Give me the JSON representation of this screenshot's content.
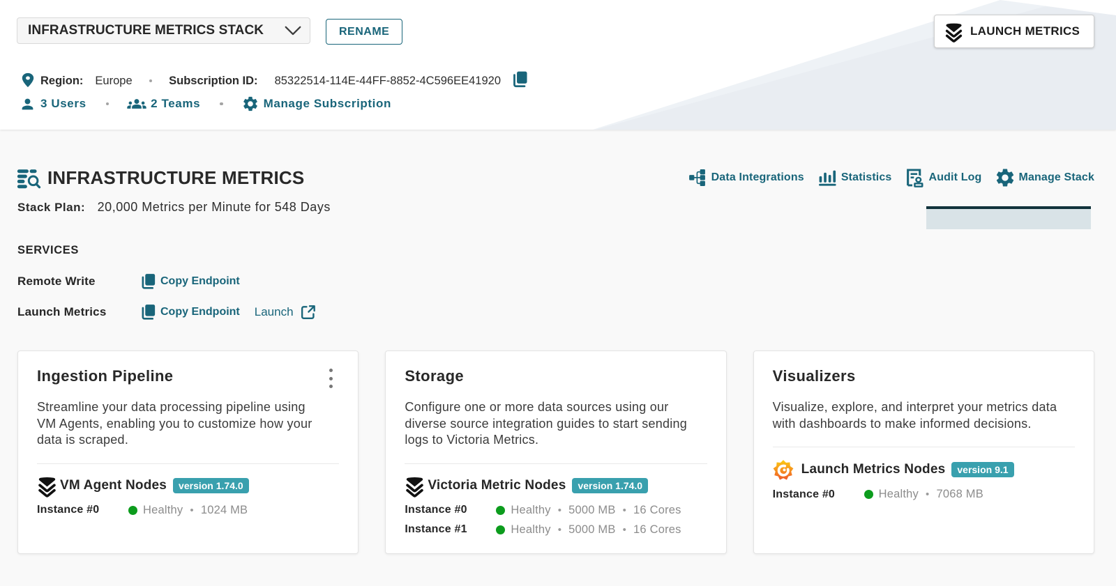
{
  "header": {
    "stack_selector": {
      "value": "INFRASTRUCTURE METRICS STACK"
    },
    "rename_label": "RENAME",
    "launch_label": "LAUNCH METRICS",
    "region_label": "Region:",
    "region_value": "Europe",
    "subscription_label": "Subscription ID:",
    "subscription_value": "85322514-114E-44FF-8852-4C596EE41920",
    "users_label": "3 Users",
    "teams_label": "2 Teams",
    "manage_subscription_label": "Manage Subscription"
  },
  "main": {
    "title": "INFRASTRUCTURE METRICS",
    "stack_plan_label": "Stack Plan:",
    "stack_plan_value": "20,000 Metrics per Minute for 548 Days",
    "nav": [
      {
        "label": "Data Integrations"
      },
      {
        "label": "Statistics"
      },
      {
        "label": "Audit Log"
      },
      {
        "label": "Manage Stack"
      }
    ],
    "services": {
      "title": "SERVICES",
      "rows": [
        {
          "name": "Remote Write",
          "copy_label": "Copy Endpoint"
        },
        {
          "name": "Launch Metrics",
          "copy_label": "Copy Endpoint",
          "launch_label": "Launch"
        }
      ]
    }
  },
  "cards": [
    {
      "title": "Ingestion Pipeline",
      "description": "Streamline your data processing pipeline using VM Agents, enabling you to customize how your data is scraped.",
      "node": {
        "name": "VM Agent Nodes",
        "version_badge": "version 1.74.0"
      },
      "instances": [
        {
          "label": "Instance #0",
          "status": "Healthy",
          "memory": "1024 MB"
        }
      ]
    },
    {
      "title": "Storage",
      "description": "Configure one or more data sources using our diverse source integration guides to start sending logs to Victoria Metrics.",
      "node": {
        "name": "Victoria Metric Nodes",
        "version_badge": "version 1.74.0"
      },
      "instances": [
        {
          "label": "Instance #0",
          "status": "Healthy",
          "memory": "5000 MB",
          "cores": "16 Cores"
        },
        {
          "label": "Instance #1",
          "status": "Healthy",
          "memory": "5000 MB",
          "cores": "16 Cores"
        }
      ]
    },
    {
      "title": "Visualizers",
      "description": "Visualize, explore, and interpret your metrics data with dashboards to make informed decisions.",
      "node": {
        "name": "Launch Metrics Nodes",
        "version_badge": "version 9.1"
      },
      "instances": [
        {
          "label": "Instance #0",
          "status": "Healthy",
          "memory": "7068 MB"
        }
      ]
    }
  ],
  "ui": {
    "bullet": "•"
  },
  "colors": {
    "accent_teal": "#19657a",
    "badge_teal": "#39a0ae",
    "healthy_green": "#0c9c1d",
    "header_wedge": "#e9eef3"
  }
}
